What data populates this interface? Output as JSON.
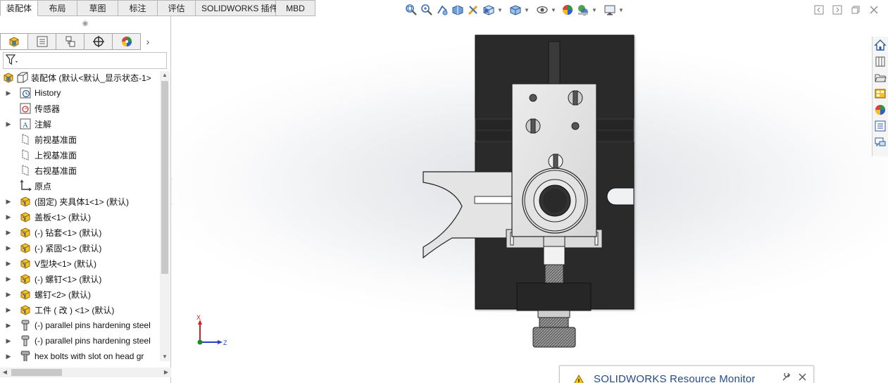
{
  "tabs": [
    {
      "label": "装配体",
      "active": true
    },
    {
      "label": "布局"
    },
    {
      "label": "草图"
    },
    {
      "label": "标注"
    },
    {
      "label": "评估"
    },
    {
      "label": "SOLIDWORKS 插件"
    },
    {
      "label": "MBD"
    }
  ],
  "heads_up_toolbar": {
    "icons": [
      "zoom-to-fit-icon",
      "zoom-to-area-icon",
      "previous-view-icon",
      "section-view-icon",
      "dynamic-annotation-icon",
      "view-orientation-icon",
      "display-style-icon",
      "hide-show-items-icon",
      "edit-appearance-icon",
      "apply-scene-icon",
      "view-settings-icon"
    ]
  },
  "window_controls": {
    "icons": [
      "tile-left-icon",
      "tile-right-icon",
      "restore-icon",
      "close-icon"
    ]
  },
  "manager_tabs": {
    "icons": [
      "feature-manager-icon",
      "property-manager-icon",
      "configuration-manager-icon",
      "dimxpert-manager-icon",
      "display-manager-icon"
    ],
    "more_icon": "chevron-right-icon"
  },
  "filter": {
    "icon": "filter-icon"
  },
  "tree": {
    "root": {
      "label": "装配体  (默认<默认_显示状态-1>"
    },
    "items": [
      {
        "label": "History",
        "icon": "history-icon",
        "expandable": true
      },
      {
        "label": "传感器",
        "icon": "sensor-icon",
        "expandable": false
      },
      {
        "label": "注解",
        "icon": "annotation-icon",
        "expandable": true
      },
      {
        "label": "前视基准面",
        "icon": "plane-icon",
        "expandable": false
      },
      {
        "label": "上视基准面",
        "icon": "plane-icon",
        "expandable": false
      },
      {
        "label": "右视基准面",
        "icon": "plane-icon",
        "expandable": false
      },
      {
        "label": "原点",
        "icon": "origin-icon",
        "expandable": false
      },
      {
        "label": "(固定) 夹具体1<1> (默认)",
        "icon": "part-icon",
        "expandable": true
      },
      {
        "label": "盖板<1> (默认)",
        "icon": "part-icon",
        "expandable": true
      },
      {
        "label": "(-) 钻套<1> (默认)",
        "icon": "part-icon",
        "expandable": true
      },
      {
        "label": "(-) 紧固<1> (默认)",
        "icon": "part-icon",
        "expandable": true
      },
      {
        "label": "V型块<1> (默认)",
        "icon": "part-icon",
        "expandable": true
      },
      {
        "label": "(-) 螺钉<1> (默认)",
        "icon": "part-icon",
        "expandable": true
      },
      {
        "label": "螺钉<2> (默认)",
        "icon": "part-icon",
        "expandable": true
      },
      {
        "label": "工件 ( 改 ) <1> (默认)",
        "icon": "part-icon",
        "expandable": true
      },
      {
        "label": "(-) parallel pins hardening steel",
        "icon": "toolbox-pin-icon",
        "expandable": true
      },
      {
        "label": "(-) parallel pins hardening steel",
        "icon": "toolbox-pin-icon",
        "expandable": true
      },
      {
        "label": "hex bolts with slot on head gr",
        "icon": "toolbox-bolt-icon",
        "expandable": true
      }
    ]
  },
  "triad": {
    "x_label": "X",
    "z_label": "Z"
  },
  "right_taskpane": {
    "icons": [
      "solidworks-resources-icon",
      "design-library-icon",
      "file-explorer-icon",
      "view-palette-icon",
      "appearances-scenes-icon",
      "custom-properties-icon",
      "forum-icon"
    ]
  },
  "resource_monitor": {
    "title": "SOLIDWORKS Resource Monitor",
    "icon": "warning-icon"
  },
  "colors": {
    "model_dark": "#2b2b2b",
    "model_plate": "#e2e2e2",
    "triad_x": "#d81f1f",
    "triad_z": "#2a3ec9",
    "triad_y": "#1d8a2a"
  }
}
